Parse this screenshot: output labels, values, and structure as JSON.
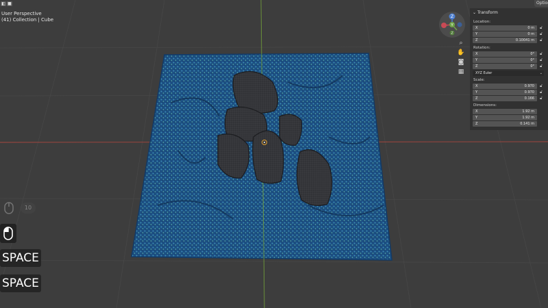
{
  "viewport": {
    "perspective_label": "User Perspective",
    "collection_label": "(41) Collection | Cube"
  },
  "top_right": {
    "options_label": "Options"
  },
  "gizmo": {
    "axis_x": "X",
    "axis_y": "Y",
    "axis_z": "Z"
  },
  "transform": {
    "header": "Transform",
    "location": {
      "label": "Location:",
      "x": {
        "axis": "X",
        "value": "0 m"
      },
      "y": {
        "axis": "Y",
        "value": "0 m"
      },
      "z": {
        "axis": "Z",
        "value": "0.10041 m"
      }
    },
    "rotation": {
      "label": "Rotation:",
      "x": {
        "axis": "X",
        "value": "0°"
      },
      "y": {
        "axis": "Y",
        "value": "0°"
      },
      "z": {
        "axis": "Z",
        "value": "0°"
      },
      "mode": "XYZ Euler"
    },
    "scale": {
      "label": "Scale:",
      "x": {
        "axis": "X",
        "value": "0.970"
      },
      "y": {
        "axis": "Y",
        "value": "0.970"
      },
      "z": {
        "axis": "Z",
        "value": "0.166"
      }
    },
    "dimensions": {
      "label": "Dimensions:",
      "x": {
        "axis": "X",
        "value": "1.92 m"
      },
      "y": {
        "axis": "Y",
        "value": "1.92 m"
      },
      "z": {
        "axis": "Z",
        "value": "0.141 m"
      }
    }
  },
  "overlay": {
    "gesture_count": "10",
    "key1": "SPACE",
    "key2": "SPACE"
  },
  "colors": {
    "background": "#3d3d3d",
    "x_axis_line": "#a8463f",
    "y_axis_line": "#6f9a3a",
    "mesh_blue": "#1f5fa0",
    "rock_dark": "#2c2d30"
  },
  "icons": [
    "hide-icon",
    "close-icon",
    "zoom-icon",
    "hand-icon",
    "camera-icon",
    "grid-icon",
    "lock-icon",
    "chevron-down-icon",
    "mouse-icon"
  ]
}
